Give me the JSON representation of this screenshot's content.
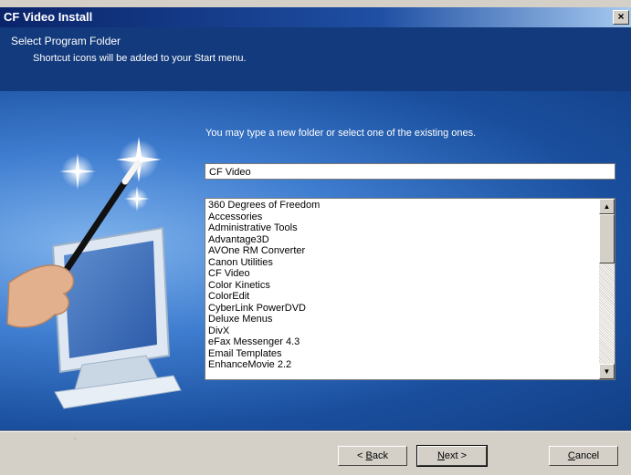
{
  "window": {
    "title": "CF Video Install",
    "close_glyph": "×"
  },
  "header": {
    "heading": "Select Program Folder",
    "subheading": "Shortcut icons will be added to your Start menu."
  },
  "main": {
    "instruction": "You may type a new folder or select one of the existing ones.",
    "folder_input_value": "CF Video",
    "folders": [
      "360 Degrees of Freedom",
      "Accessories",
      "Administrative Tools",
      "Advantage3D",
      "AVOne RM Converter",
      "Canon Utilities",
      "CF Video",
      "Color Kinetics",
      "ColorEdit",
      "CyberLink PowerDVD",
      "Deluxe Menus",
      "DivX",
      "eFax Messenger 4.3",
      "Email Templates",
      "EnhanceMovie 2.2"
    ]
  },
  "footer": {
    "back_prefix": "< ",
    "back_mnemonic": "B",
    "back_rest": "ack",
    "next_mnemonic": "N",
    "next_rest": "ext >",
    "cancel_mnemonic": "C",
    "cancel_rest": "ancel"
  },
  "icons": {
    "scroll_up": "▲",
    "scroll_down": "▼"
  }
}
